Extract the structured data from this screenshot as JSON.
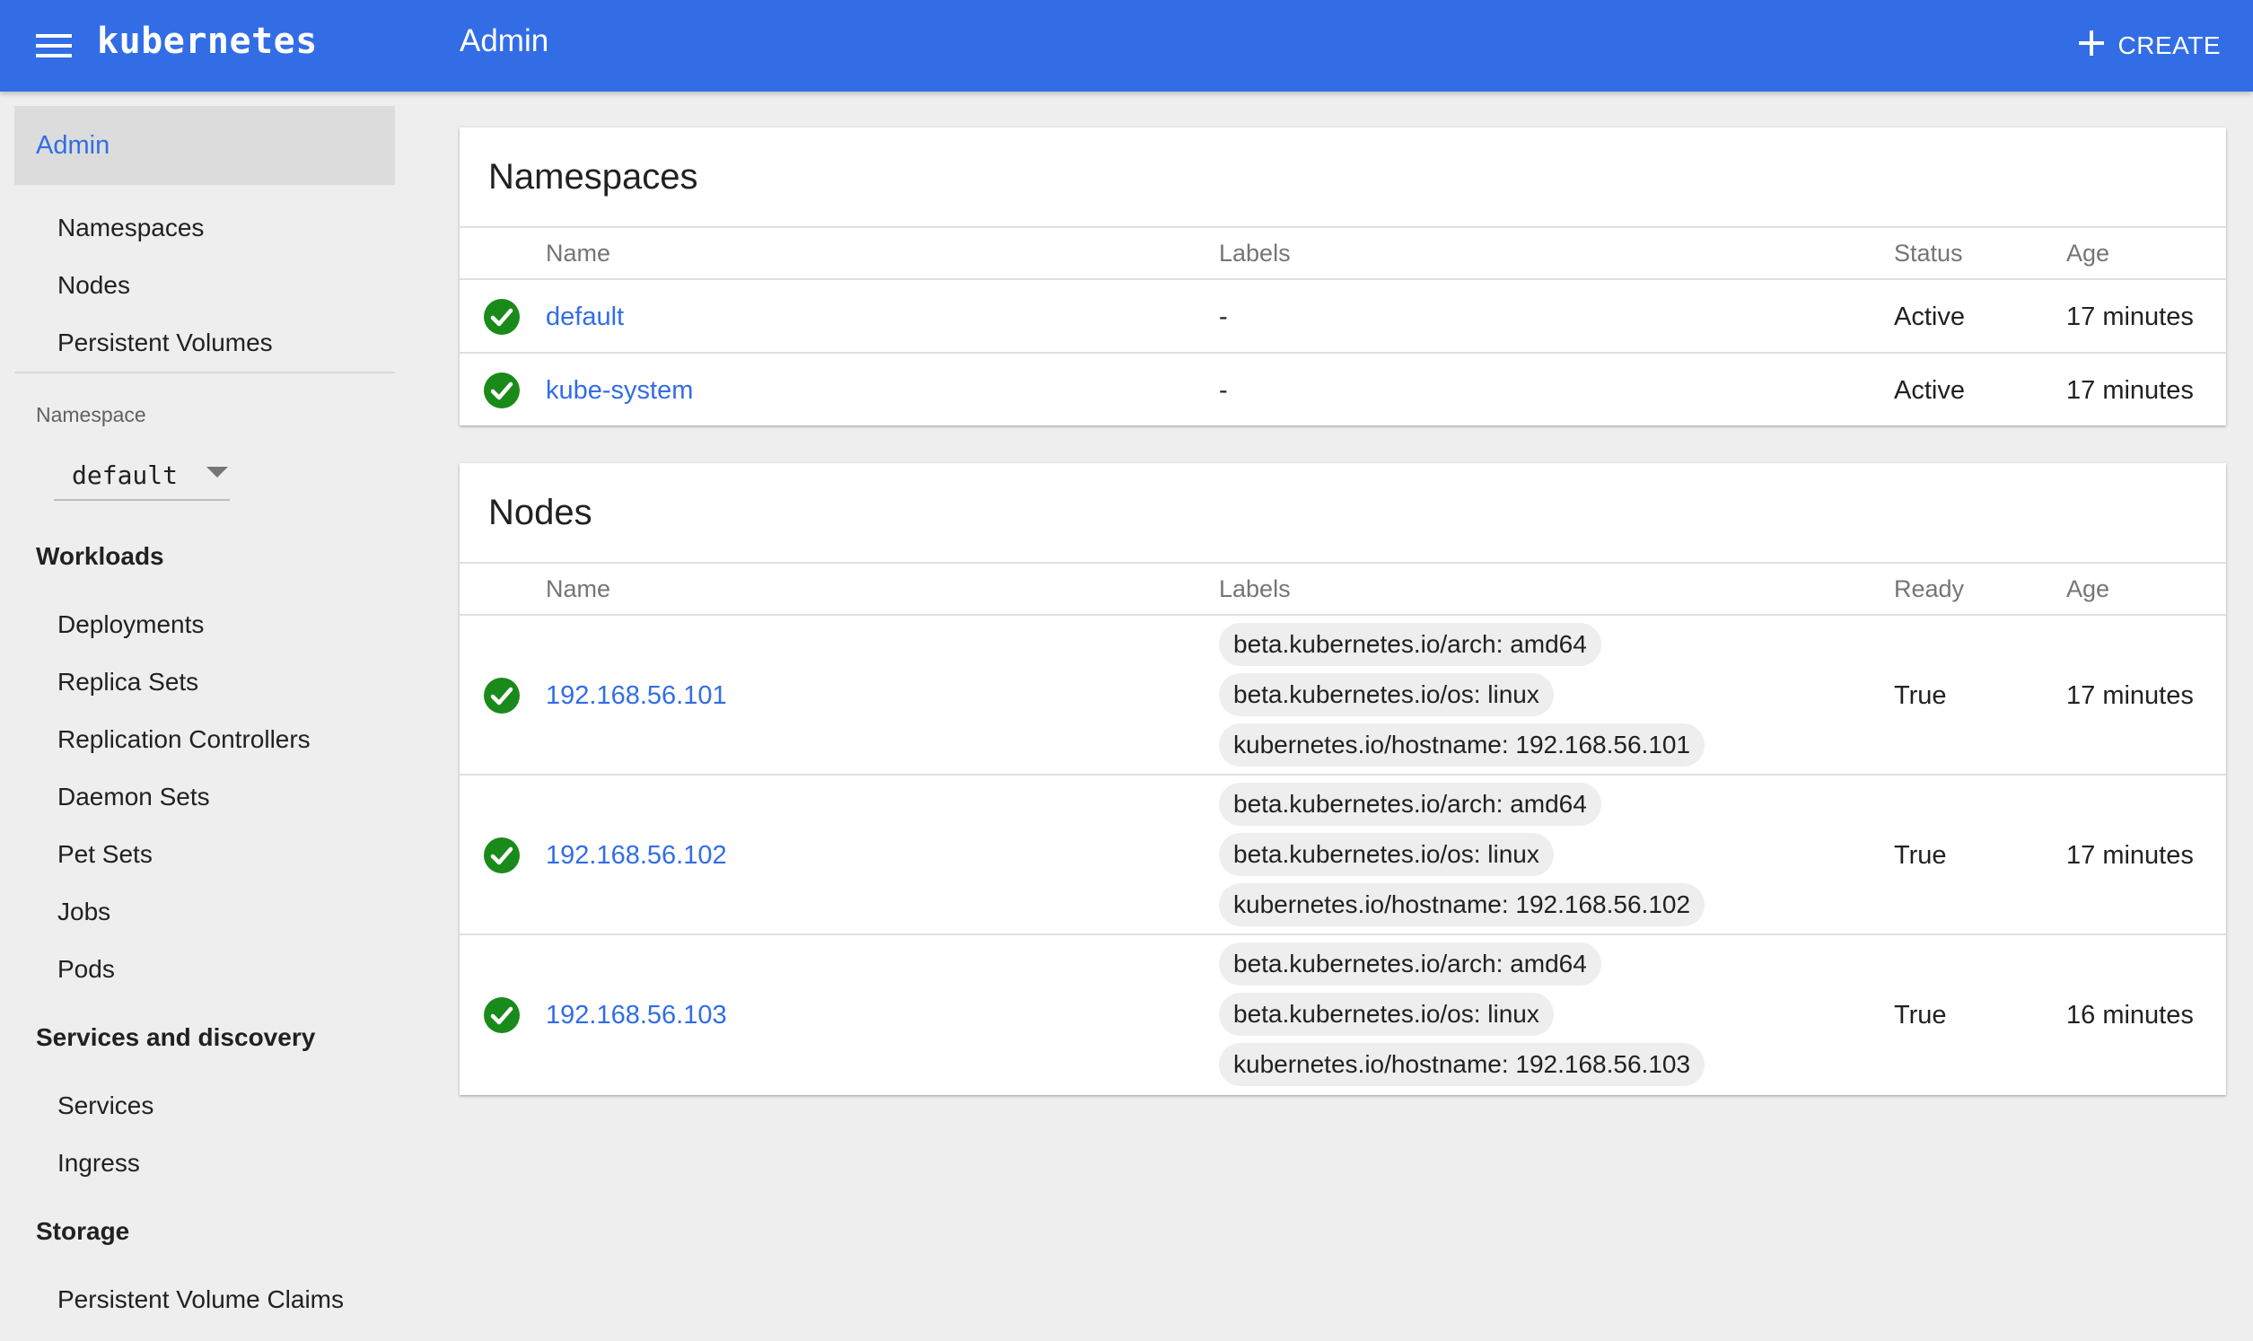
{
  "colors": {
    "brand_blue": "#326de6",
    "status_green": "#1a8a1a",
    "background": "#eeeeee"
  },
  "topbar": {
    "menu_icon": "hamburger-menu-icon",
    "brand": "kubernetes",
    "title": "Admin",
    "create_icon": "plus-icon",
    "create_label": "CREATE"
  },
  "sidebar": {
    "active_item": "Admin",
    "admin_items": [
      "Namespaces",
      "Nodes",
      "Persistent Volumes"
    ],
    "namespace_label": "Namespace",
    "namespace_selected": "default",
    "sections": [
      {
        "title": "Workloads",
        "items": [
          "Deployments",
          "Replica Sets",
          "Replication Controllers",
          "Daemon Sets",
          "Pet Sets",
          "Jobs",
          "Pods"
        ]
      },
      {
        "title": "Services and discovery",
        "items": [
          "Services",
          "Ingress"
        ]
      },
      {
        "title": "Storage",
        "items": [
          "Persistent Volume Claims"
        ]
      }
    ]
  },
  "namespaces": {
    "title": "Namespaces",
    "columns": [
      "Name",
      "Labels",
      "Status",
      "Age"
    ],
    "rows": [
      {
        "name": "default",
        "labels": "-",
        "status": "Active",
        "age": "17 minutes",
        "icon": "check-circle-icon"
      },
      {
        "name": "kube-system",
        "labels": "-",
        "status": "Active",
        "age": "17 minutes",
        "icon": "check-circle-icon"
      }
    ]
  },
  "nodes": {
    "title": "Nodes",
    "columns": [
      "Name",
      "Labels",
      "Ready",
      "Age"
    ],
    "rows": [
      {
        "name": "192.168.56.101",
        "labels": [
          "beta.kubernetes.io/arch: amd64",
          "beta.kubernetes.io/os: linux",
          "kubernetes.io/hostname: 192.168.56.101"
        ],
        "ready": "True",
        "age": "17 minutes",
        "icon": "check-circle-icon"
      },
      {
        "name": "192.168.56.102",
        "labels": [
          "beta.kubernetes.io/arch: amd64",
          "beta.kubernetes.io/os: linux",
          "kubernetes.io/hostname: 192.168.56.102"
        ],
        "ready": "True",
        "age": "17 minutes",
        "icon": "check-circle-icon"
      },
      {
        "name": "192.168.56.103",
        "labels": [
          "beta.kubernetes.io/arch: amd64",
          "beta.kubernetes.io/os: linux",
          "kubernetes.io/hostname: 192.168.56.103"
        ],
        "ready": "True",
        "age": "16 minutes",
        "icon": "check-circle-icon"
      }
    ]
  }
}
